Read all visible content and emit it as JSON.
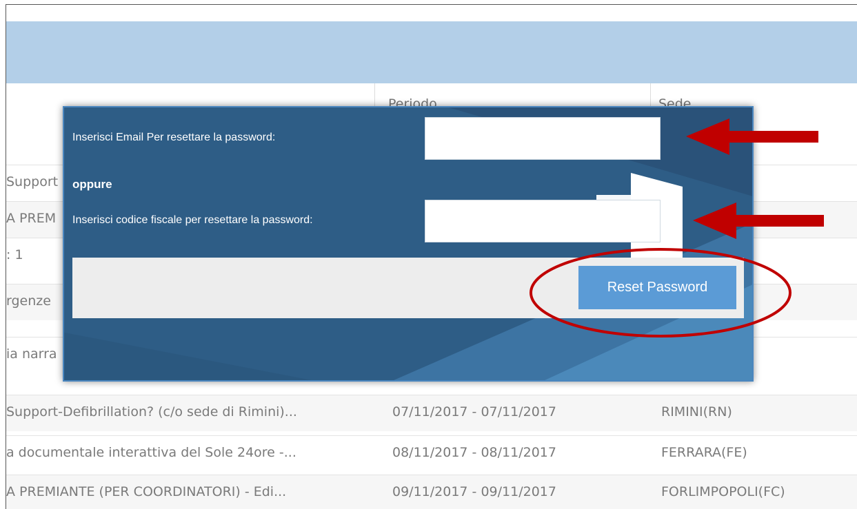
{
  "columns": {
    "period": "Periodo",
    "location": "Sede"
  },
  "rows": [
    {
      "title": "Support",
      "period": "",
      "location": ")"
    },
    {
      "title": "A PREM",
      "period": "",
      "location": ")"
    },
    {
      "title": ": 1",
      "period": "",
      "location": ")"
    },
    {
      "title": "rgenze",
      "period": "",
      "location": ")"
    },
    {
      "title": "ia narra",
      "period": "",
      "location": "E)"
    },
    {
      "title": "Support-Defibrillation? (c/o sede di Rimini)...",
      "period": "07/11/2017 - 07/11/2017",
      "location": "RIMINI(RN)"
    },
    {
      "title": "a documentale interattiva del Sole 24ore -...",
      "period": "08/11/2017 - 08/11/2017",
      "location": "FERRARA(FE)"
    },
    {
      "title": "A PREMIANTE (PER COORDINATORI) - Edi...",
      "period": "09/11/2017 - 09/11/2017",
      "location": "FORLIMPOPOLI(FC)"
    }
  ],
  "modal": {
    "email_label": "Inserisci Email Per resettare la password:",
    "email_value": "",
    "or_label": "oppure",
    "cf_label": "Inserisci codice fiscale per resettare la password:",
    "cf_value": "",
    "reset_button": "Reset Password"
  },
  "colors": {
    "header_band": "#b3cfe8",
    "modal_bg": "#2e5d86",
    "button": "#5b9bd6",
    "annotation": "#c00000"
  },
  "annotations": {
    "arrows": 2,
    "ellipse": "around-reset-button"
  }
}
